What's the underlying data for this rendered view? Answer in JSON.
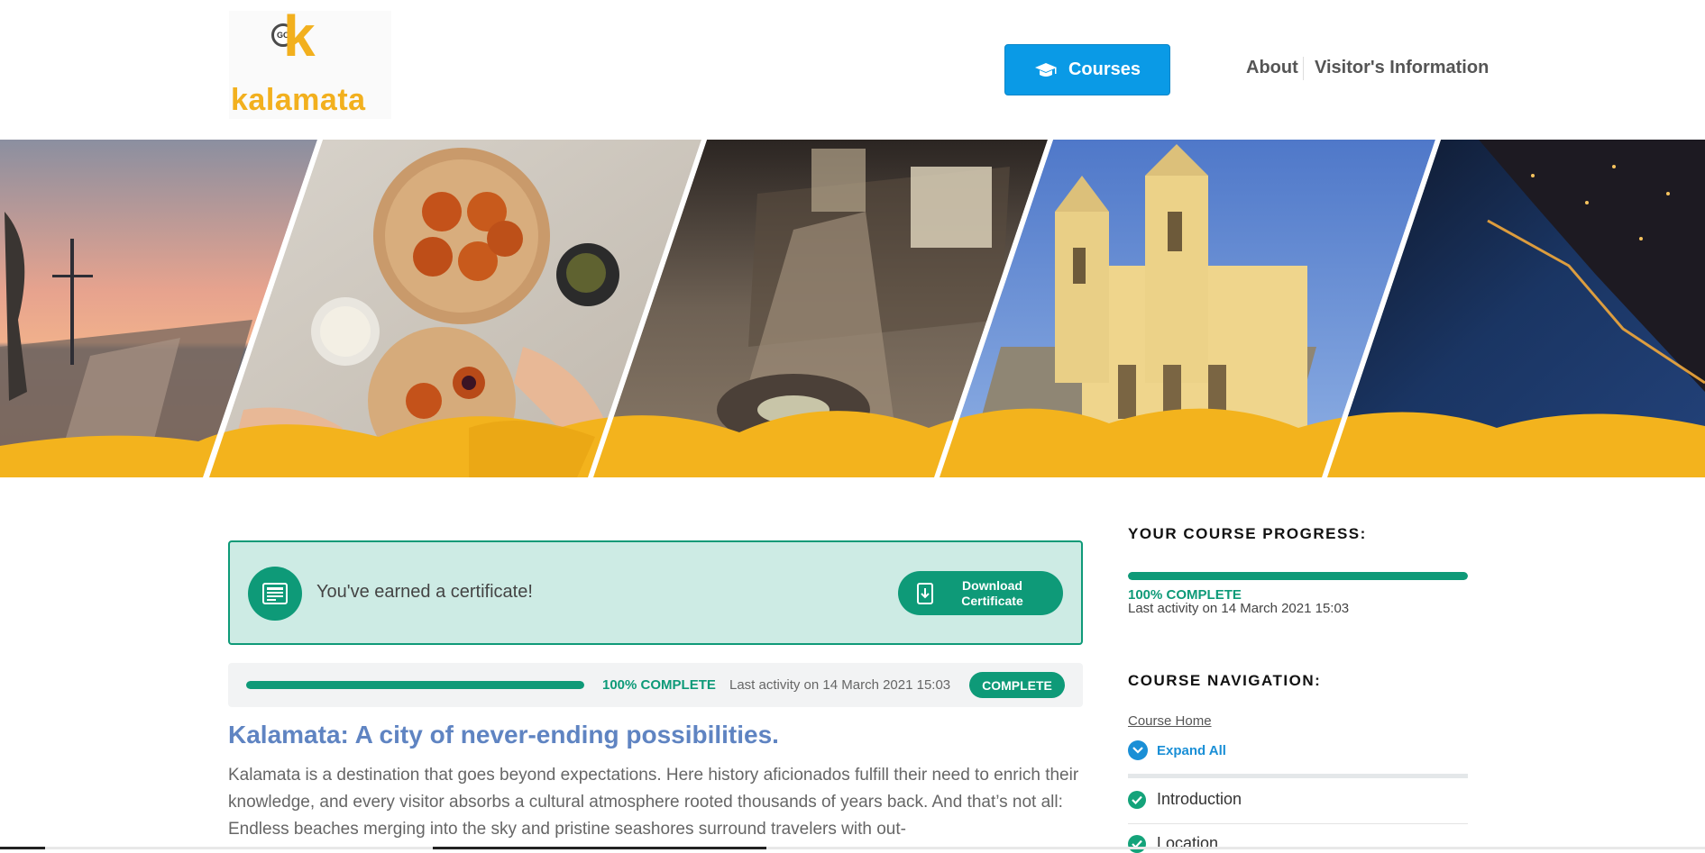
{
  "header": {
    "logo": {
      "badge_text": "GO",
      "letter": "k",
      "wordmark": "kalamata"
    },
    "courses_label": "Courses",
    "nav": {
      "about": "About",
      "visitor_info": "Visitor's Information"
    }
  },
  "banner": {
    "panels": [
      "waterfront-promenade-sunset",
      "food-platter",
      "city-square-night",
      "church",
      "coastline-night"
    ]
  },
  "certificate": {
    "message": "You've earned a certificate!",
    "download_label_line1": "Download",
    "download_label_line2": "Certificate"
  },
  "progress": {
    "fraction": 1.0,
    "percent_text": "100% COMPLETE",
    "last_activity": "Last activity on 14 March 2021 15:03",
    "status_badge": "COMPLETE"
  },
  "article": {
    "title": "Kalamata: A city of never-ending possibilities.",
    "body": "Kalamata is a destination that goes beyond expectations. Here history aficionados fulfill their need to enrich their knowledge, and every visitor absorbs a cultural atmosphere rooted thousands of years back. And that’s not all: Endless beaches merging into the sky and pristine seashores surround travelers with out-"
  },
  "sidebar": {
    "progress_heading": "YOUR COURSE PROGRESS:",
    "progress_fraction": 1.0,
    "progress_percent": "100% COMPLETE",
    "last_activity": "Last activity on 14 March 2021 15:03",
    "navigation_heading": "COURSE NAVIGATION:",
    "course_home": "Course Home",
    "expand_all": "Expand All",
    "lessons": [
      {
        "label": "Introduction",
        "completed": true
      },
      {
        "label": "Location",
        "completed": true
      }
    ]
  },
  "colors": {
    "accent_green": "#0e9a78",
    "courses_blue": "#0a9ae6",
    "title_blue": "#5f84c2",
    "logo_yellow": "#f2b01e"
  }
}
